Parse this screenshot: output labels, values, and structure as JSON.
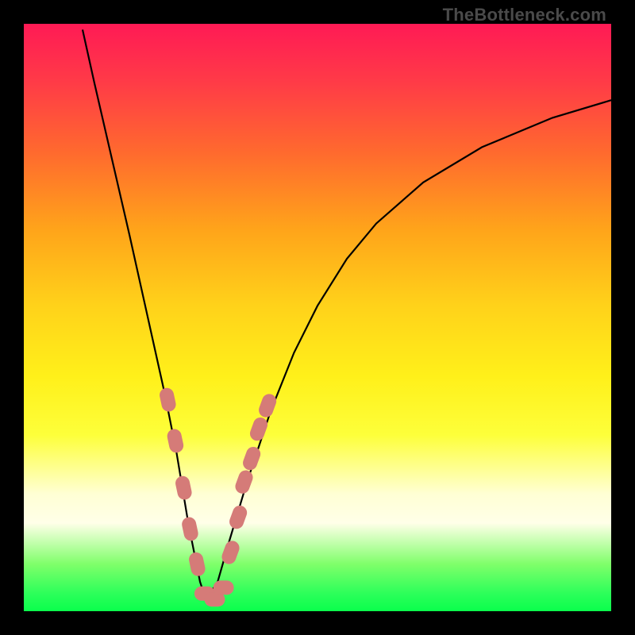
{
  "attribution": "TheBottleneck.com",
  "colors": {
    "background": "#000000",
    "gradient_top": "#ff1a55",
    "gradient_bottom": "#0aff4c",
    "curve": "#000000",
    "marker": "#d57b78"
  },
  "chart_data": {
    "type": "line",
    "title": "",
    "xlabel": "",
    "ylabel": "",
    "xlim": [
      0,
      100
    ],
    "ylim": [
      0,
      100
    ],
    "grid": false,
    "legend": false,
    "series": [
      {
        "name": "curve-left",
        "x": [
          10,
          12,
          15,
          18,
          20,
          22,
          24,
          26,
          27,
          28,
          29,
          30,
          31
        ],
        "y": [
          99,
          90,
          77,
          64,
          55,
          46,
          37,
          27,
          21,
          15,
          10,
          5,
          2
        ]
      },
      {
        "name": "curve-right",
        "x": [
          31,
          33,
          35,
          38,
          42,
          46,
          50,
          55,
          60,
          68,
          78,
          90,
          100
        ],
        "y": [
          2,
          5,
          12,
          22,
          34,
          44,
          52,
          60,
          66,
          73,
          79,
          84,
          87
        ]
      }
    ],
    "markers_left": [
      {
        "x": 24.5,
        "y": 36
      },
      {
        "x": 25.8,
        "y": 29
      },
      {
        "x": 27.2,
        "y": 21
      },
      {
        "x": 28.3,
        "y": 14
      },
      {
        "x": 29.5,
        "y": 8
      }
    ],
    "markers_bottom": [
      {
        "x": 30.8,
        "y": 3
      },
      {
        "x": 32.5,
        "y": 2
      },
      {
        "x": 34.0,
        "y": 4
      }
    ],
    "markers_right": [
      {
        "x": 35.2,
        "y": 10
      },
      {
        "x": 36.5,
        "y": 16
      },
      {
        "x": 37.5,
        "y": 22
      },
      {
        "x": 38.8,
        "y": 26
      },
      {
        "x": 40.0,
        "y": 31
      },
      {
        "x": 41.5,
        "y": 35
      }
    ]
  }
}
